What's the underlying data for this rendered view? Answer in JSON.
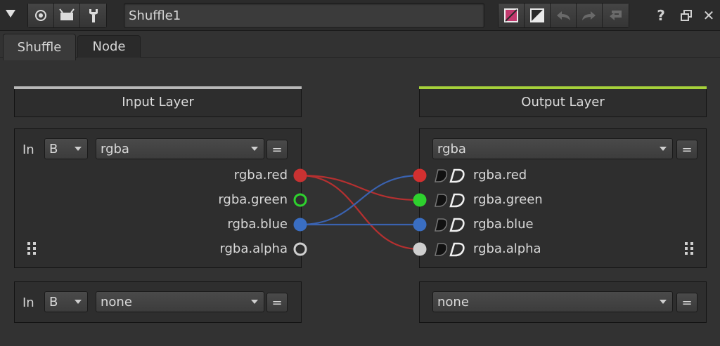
{
  "toolbar": {
    "node_name": "Shuffle1",
    "icons": [
      "collapse-icon",
      "viewer-icon",
      "monitor-icon",
      "wrench-icon"
    ],
    "right_icons": [
      "color-swatch-icon",
      "mask-swatch-icon",
      "undo-icon",
      "redo-icon",
      "revert-icon"
    ],
    "swatch_color": "#c2386e",
    "window_buttons": {
      "help": "?",
      "float": "⧉",
      "close": "✕"
    }
  },
  "tabs": [
    {
      "label": "Shuffle",
      "active": true
    },
    {
      "label": "Node",
      "active": false
    }
  ],
  "input_panel": {
    "header": "Input Layer",
    "stripe_color": "#b8b8b8",
    "inputs": [
      {
        "label": "In",
        "source": "B",
        "layer": "rgba",
        "eq": "="
      },
      {
        "label": "In",
        "source": "B",
        "layer": "none",
        "eq": "="
      }
    ],
    "channels": [
      {
        "name": "rgba.red",
        "color": "#c83232",
        "filled": true
      },
      {
        "name": "rgba.green",
        "color": "#2ed12e",
        "filled": false
      },
      {
        "name": "rgba.blue",
        "color": "#3a6ec2",
        "filled": true
      },
      {
        "name": "rgba.alpha",
        "color": "#cfcfcf",
        "filled": false
      }
    ]
  },
  "output_panel": {
    "header": "Output Layer",
    "stripe_color": "#a6d13a",
    "outputs": [
      {
        "layer": "rgba",
        "eq": "="
      },
      {
        "layer": "none",
        "eq": "="
      }
    ],
    "channels": [
      {
        "name": "rgba.red",
        "color": "#d33030"
      },
      {
        "name": "rgba.green",
        "color": "#2ed12e"
      },
      {
        "name": "rgba.blue",
        "color": "#3a6ec2"
      },
      {
        "name": "rgba.alpha",
        "color": "#cfcfcf"
      }
    ]
  },
  "connections": [
    {
      "from": "rgba.red",
      "to": "rgba.green",
      "color": "#b53030"
    },
    {
      "from": "rgba.red",
      "to": "rgba.alpha",
      "color": "#b53030"
    },
    {
      "from": "rgba.blue",
      "to": "rgba.red",
      "color": "#3a62b0"
    },
    {
      "from": "rgba.blue",
      "to": "rgba.blue",
      "color": "#3a62b0"
    }
  ]
}
